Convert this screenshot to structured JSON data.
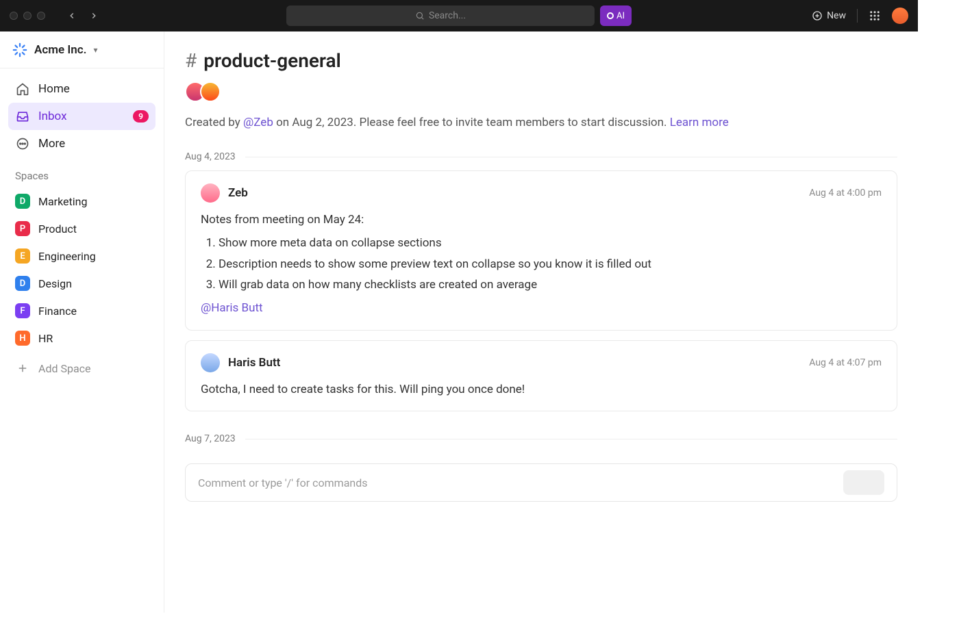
{
  "topbar": {
    "search_placeholder": "Search...",
    "ai_label": "AI",
    "new_label": "New"
  },
  "workspace": {
    "name": "Acme Inc."
  },
  "sidebar": {
    "nav": [
      {
        "label": "Home"
      },
      {
        "label": "Inbox",
        "badge": "9"
      },
      {
        "label": "More"
      }
    ],
    "spaces_label": "Spaces",
    "spaces": [
      {
        "initial": "D",
        "label": "Marketing",
        "color": "#0fa968"
      },
      {
        "initial": "P",
        "label": "Product",
        "color": "#e92c4a"
      },
      {
        "initial": "E",
        "label": "Engineering",
        "color": "#f5a623"
      },
      {
        "initial": "D",
        "label": "Design",
        "color": "#2f80ed"
      },
      {
        "initial": "F",
        "label": "Finance",
        "color": "#7b3ff2"
      },
      {
        "initial": "H",
        "label": "HR",
        "color": "#ff6a2b"
      }
    ],
    "add_space_label": "Add Space"
  },
  "channel": {
    "name": "product-general",
    "created_prefix": "Created by ",
    "created_by": "@Zeb",
    "created_suffix": " on Aug 2, 2023. Please feel free to invite team members to start discussion. ",
    "learn_more": "Learn more"
  },
  "timeline": {
    "date1": "Aug 4, 2023",
    "date2": "Aug 7, 2023"
  },
  "messages": [
    {
      "author": "Zeb",
      "time": "Aug 4 at 4:00 pm",
      "intro": "Notes from meeting on May 24:",
      "items": [
        "Show more meta data on collapse sections",
        "Description needs to show some preview text on collapse so you know it is filled out",
        "Will grab data on how many checklists are created on average"
      ],
      "mention": "@Haris Butt"
    },
    {
      "author": "Haris Butt",
      "time": "Aug 4 at 4:07 pm",
      "text": "Gotcha, I need to create tasks for this. Will ping you once done!"
    }
  ],
  "composer": {
    "placeholder": "Comment or type '/' for commands"
  }
}
